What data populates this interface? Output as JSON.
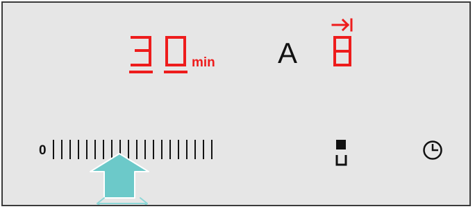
{
  "timer": {
    "digit_tens": "3",
    "digit_units": "0",
    "unit_label": "min"
  },
  "mode": {
    "label": "A"
  },
  "power": {
    "level": "8",
    "boost_icon": "arrow-to-bar-right-icon"
  },
  "power_slider": {
    "zero_label": "0",
    "tick_count": 20,
    "selected_tick": 9
  },
  "controls": {
    "zone_icon": "cooking-zone-select-icon",
    "timer_icon": "clock-icon"
  },
  "gesture_hint": {
    "icon": "tap-and-slide-arrow-icon"
  },
  "colors": {
    "display_red": "#ee1c1c",
    "panel_bg": "#e6e6e6",
    "hint_fill": "#6cc9c9",
    "hint_arrow": "#8cd7d7"
  }
}
